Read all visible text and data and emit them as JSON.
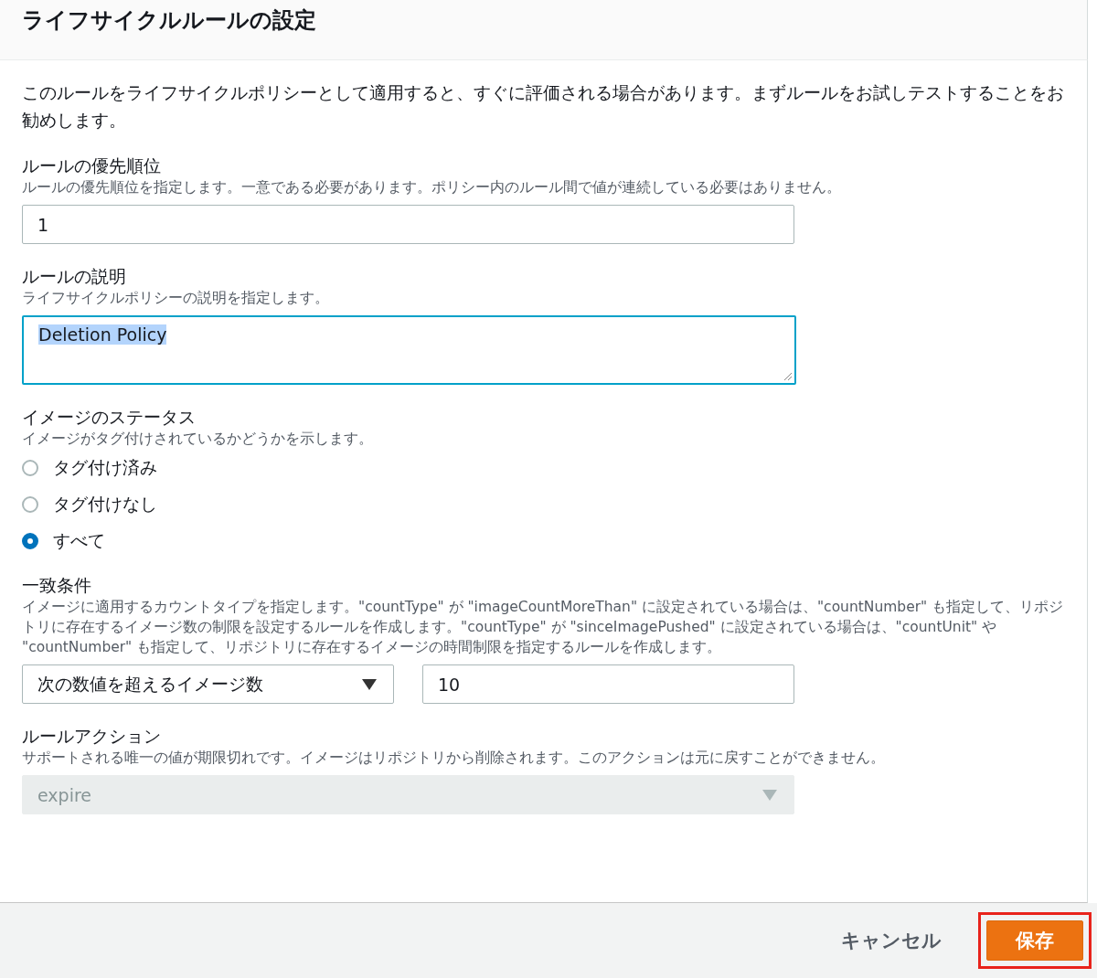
{
  "header": {
    "title": "ライフサイクルルールの設定"
  },
  "intro": "このルールをライフサイクルポリシーとして適用すると、すぐに評価される場合があります。まずルールをお試しテストすることをお勧めします。",
  "priority": {
    "label": "ルールの優先順位",
    "hint": "ルールの優先順位を指定します。一意である必要があります。ポリシー内のルール間で値が連続している必要はありません。",
    "value": "1"
  },
  "description": {
    "label": "ルールの説明",
    "hint": "ライフサイクルポリシーの説明を指定します。",
    "value": "Deletion Policy",
    "focused": true,
    "text_selected": true
  },
  "image_status": {
    "label": "イメージのステータス",
    "hint": "イメージがタグ付けされているかどうかを示します。",
    "options": [
      {
        "label": "タグ付け済み",
        "selected": false
      },
      {
        "label": "タグ付けなし",
        "selected": false
      },
      {
        "label": "すべて",
        "selected": true
      }
    ]
  },
  "match": {
    "label": "一致条件",
    "hint": "イメージに適用するカウントタイプを指定します。\"countType\" が \"imageCountMoreThan\" に設定されている場合は、\"countNumber\" も指定して、リポジトリに存在するイメージ数の制限を設定するルールを作成します。\"countType\" が \"sinceImagePushed\" に設定されている場合は、\"countUnit\" や \"countNumber\" も指定して、リポジトリに存在するイメージの時間制限を指定するルールを作成します。",
    "count_type": "次の数値を超えるイメージ数",
    "count_number": "10"
  },
  "action": {
    "label": "ルールアクション",
    "hint": "サポートされる唯一の値が期限切れです。イメージはリポジトリから削除されます。このアクションは元に戻すことができません。",
    "value": "expire",
    "disabled": true
  },
  "footer": {
    "cancel": "キャンセル",
    "save": "保存",
    "save_highlighted": true
  }
}
